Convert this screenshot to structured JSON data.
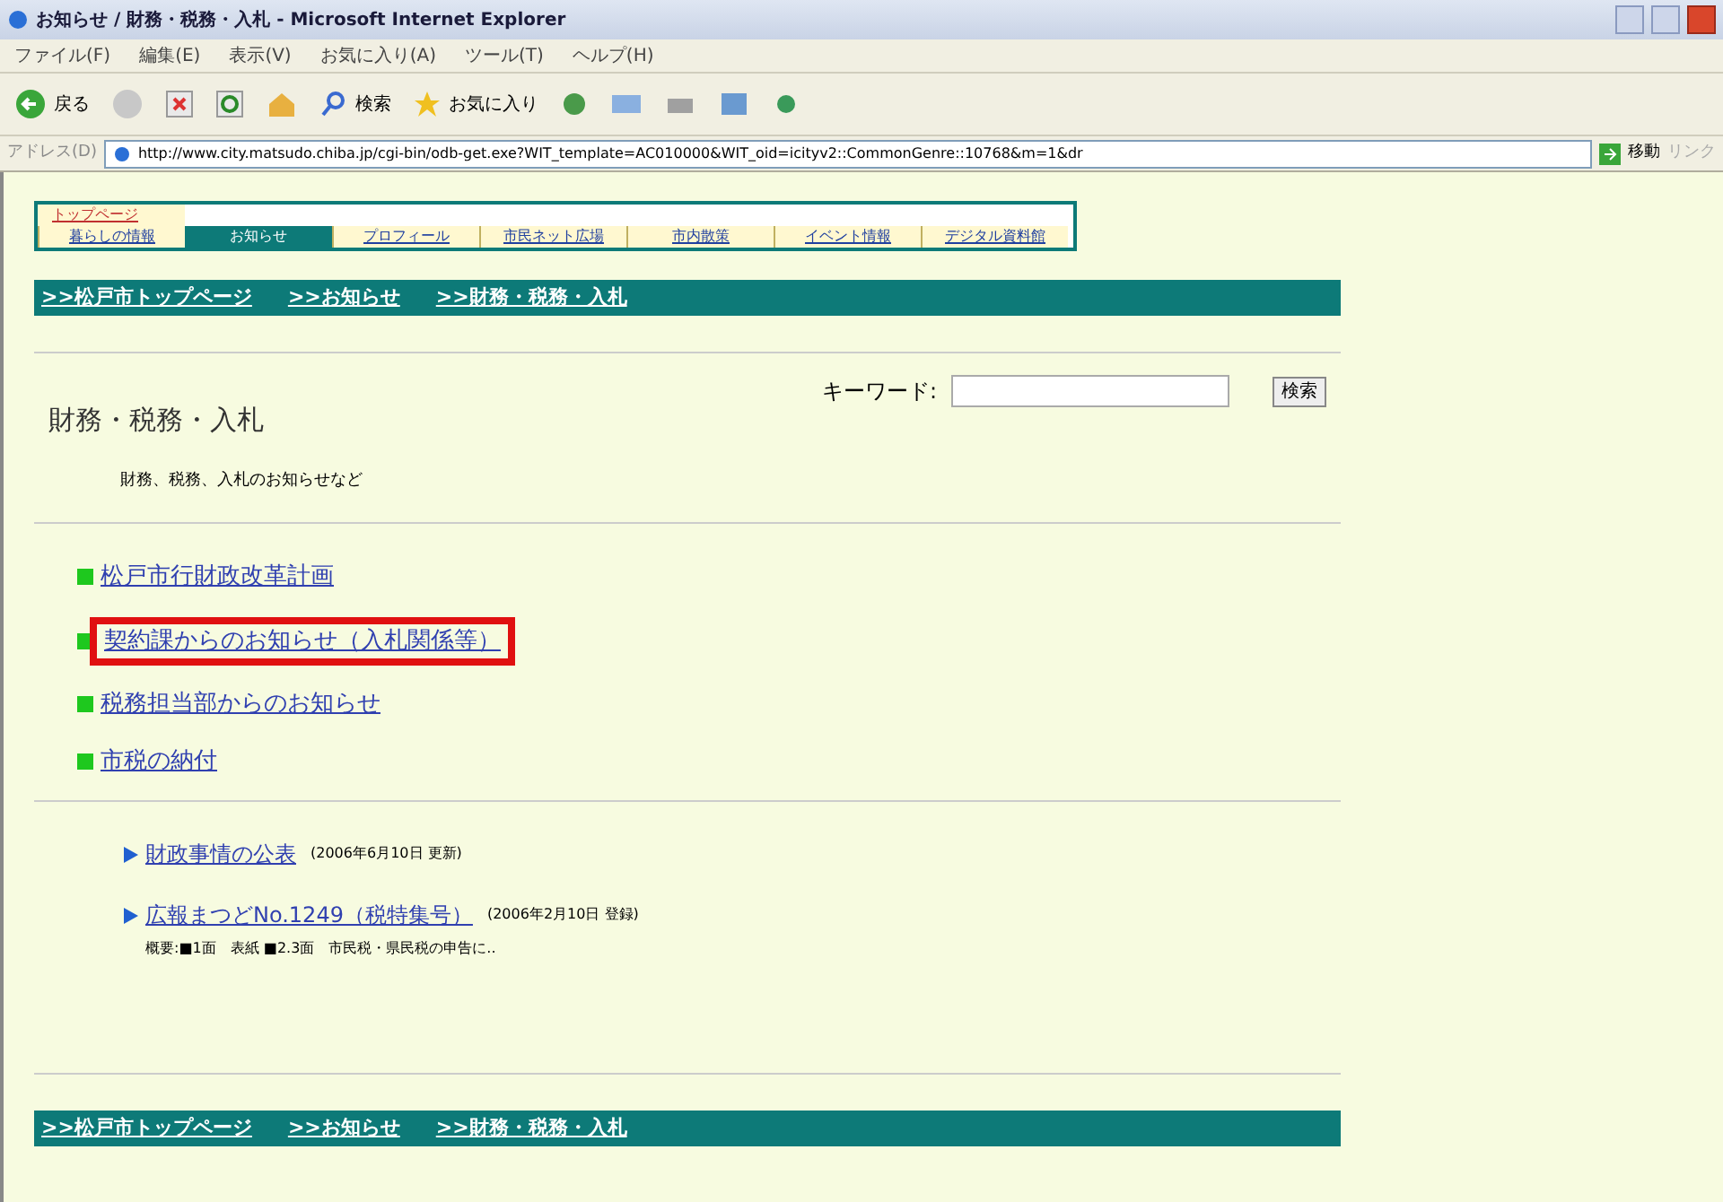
{
  "window": {
    "title": "お知らせ / 財務・税務・入札 - Microsoft Internet Explorer"
  },
  "menu": [
    "ファイル(F)",
    "編集(E)",
    "表示(V)",
    "お気に入り(A)",
    "ツール(T)",
    "ヘルプ(H)"
  ],
  "toolbar": {
    "back": "戻る",
    "search": "検索",
    "favorites": "お気に入り"
  },
  "address_bar": {
    "label": "アドレス(D)",
    "value": "http://www.city.matsudo.chiba.jp/cgi-bin/odb-get.exe?WIT_template=AC010000&WIT_oid=icityv2::CommonGenre::10768&m=1&dr",
    "go": "移動",
    "links": "リンク"
  },
  "site_nav": {
    "top": "トップページ",
    "tabs": [
      {
        "label": "暮らしの情報",
        "selected": false
      },
      {
        "label": "お知らせ",
        "selected": true
      },
      {
        "label": "プロフィール",
        "selected": false
      },
      {
        "label": "市民ネット広場",
        "selected": false
      },
      {
        "label": "市内散策",
        "selected": false
      },
      {
        "label": "イベント情報",
        "selected": false
      },
      {
        "label": "デジタル資料館",
        "selected": false
      }
    ]
  },
  "breadcrumb_top": [
    ">>松戸市トップページ",
    ">>お知らせ",
    ">>財務・税務・入札"
  ],
  "search": {
    "label": "キーワード:",
    "button": "検索"
  },
  "heading": "財務・税務・入札",
  "description": "財務、税務、入札のお知らせなど",
  "categories": [
    {
      "label": "松戸市行財政改革計画",
      "highlighted": false
    },
    {
      "label": "契約課からのお知らせ（入札関係等）",
      "highlighted": true
    },
    {
      "label": "税務担当部からのお知らせ",
      "highlighted": false
    },
    {
      "label": "市税の納付",
      "highlighted": false
    }
  ],
  "articles": [
    {
      "title": "財政事情の公表",
      "date": "(2006年6月10日 更新)"
    },
    {
      "title": "広報まつどNo.1249（税特集号）",
      "date": "(2006年2月10日 登録)",
      "summary": "概要:■1面　表紙 ■2.3面　市民税・県民税の申告に.."
    }
  ],
  "breadcrumb_bottom": [
    ">>松戸市トップページ",
    ">>お知らせ",
    ">>財務・税務・入札"
  ]
}
